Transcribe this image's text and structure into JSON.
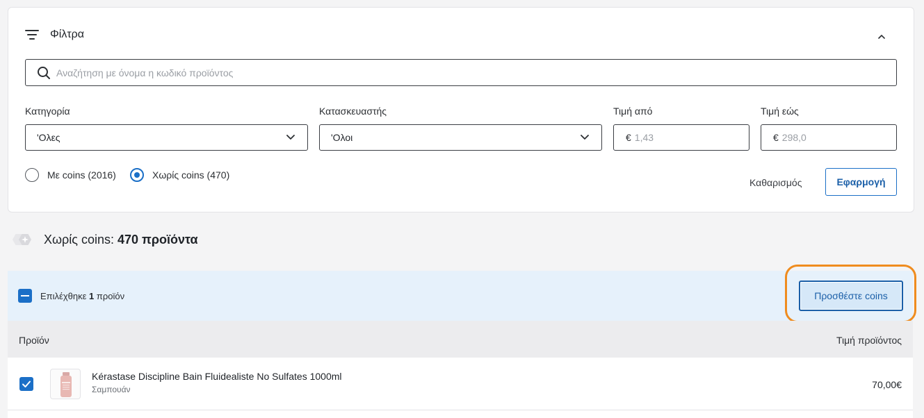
{
  "filters": {
    "title": "Φίλτρα",
    "search_placeholder": "Αναζήτηση με όνομα η κωδικό προϊόντος",
    "category": {
      "label": "Κατηγορία",
      "value": "'Ολες"
    },
    "manufacturer": {
      "label": "Κατασκευαστής",
      "value": "'Ολοι"
    },
    "price_from": {
      "label": "Τιμή από",
      "currency": "€",
      "placeholder": "1,43"
    },
    "price_to": {
      "label": "Τιμή εώς",
      "currency": "€",
      "placeholder": "298,0"
    },
    "radio_with_coins": "Με coins (2016)",
    "radio_without_coins": "Χωρίς coins (470)",
    "selected_radio": "without_coins",
    "clear_label": "Καθαρισμός",
    "apply_label": "Εφαρμογή"
  },
  "results": {
    "title_prefix": "Χωρίς coins:",
    "title_count": "470 προϊόντα"
  },
  "selection": {
    "prefix": "Επιλέχθηκε",
    "count": "1",
    "suffix": "προϊόν",
    "add_coins_label": "Προσθέστε coins"
  },
  "table": {
    "col_product": "Προϊόν",
    "col_price": "Τιμή προϊόντος",
    "rows": [
      {
        "name": "Kérastase Discipline Bain Fluidealiste No Sulfates 1000ml",
        "category": "Σαμπουάν",
        "price": "70,00€",
        "checked": true
      }
    ]
  },
  "colors": {
    "accent": "#1b6fc7",
    "highlight": "#ef8c1f",
    "selection_bg": "#e6f1fb"
  }
}
